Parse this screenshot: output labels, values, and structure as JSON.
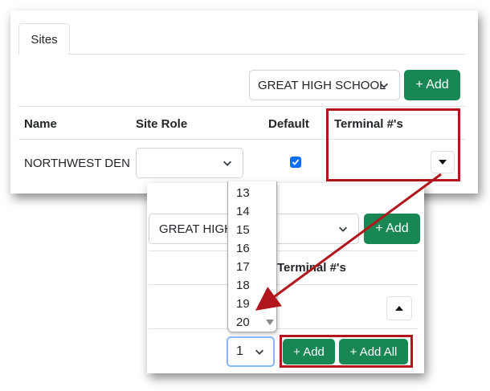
{
  "top": {
    "tab_label": "Sites",
    "school_select": "GREAT HIGH SCHOOL",
    "add_label": "+ Add",
    "headers": {
      "name": "Name",
      "site_role": "Site Role",
      "default": "Default",
      "terminals": "Terminal #'s"
    },
    "row": {
      "name": "NORTHWEST DEN",
      "default_checked": true
    }
  },
  "bottom": {
    "school_select": "GREAT HIGH",
    "add_label": "+ Add",
    "terminals_header": "Terminal #'s",
    "dropdown_items": [
      "13",
      "14",
      "15",
      "16",
      "17",
      "18",
      "19",
      "20"
    ],
    "qty_value": "1",
    "add_btn": "+ Add",
    "add_all_btn": "+ Add All"
  },
  "colors": {
    "green": "#198754",
    "highlight": "#b0161c",
    "checkbox": "#0d6efd"
  }
}
